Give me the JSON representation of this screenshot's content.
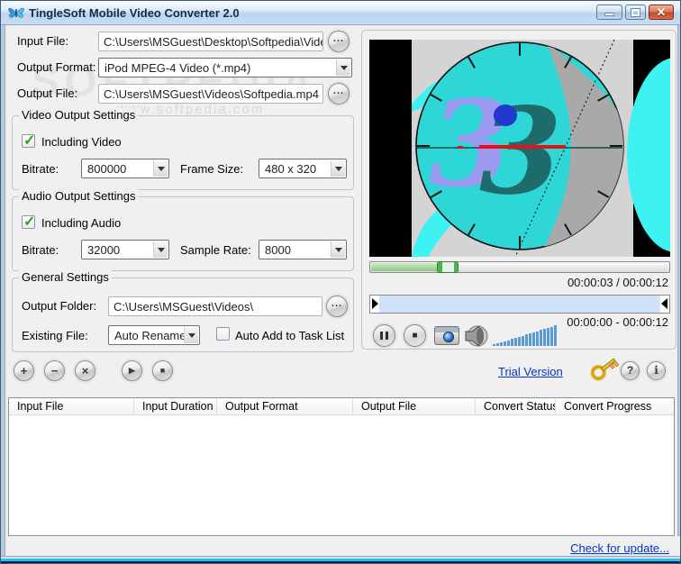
{
  "window": {
    "title": "TingleSoft Mobile Video Converter 2.0"
  },
  "watermark": {
    "line1": "SOFTPEDIA",
    "line2": "www.softpedia.com"
  },
  "file_section": {
    "input_file": {
      "label": "Input File:",
      "value": "C:\\Users\\MSGuest\\Desktop\\Softpedia\\Video\\Softp",
      "browse": "..."
    },
    "output_format": {
      "label": "Output Format:",
      "value": "iPod MPEG-4 Video (*.mp4)"
    },
    "output_file": {
      "label": "Output File:",
      "value": "C:\\Users\\MSGuest\\Videos\\Softpedia.mp4",
      "browse": "..."
    }
  },
  "video_settings": {
    "title": "Video Output Settings",
    "including_label": "Including Video",
    "including_checked": true,
    "bitrate_label": "Bitrate:",
    "bitrate_value": "800000",
    "frame_size_label": "Frame Size:",
    "frame_size_value": "480 x 320"
  },
  "audio_settings": {
    "title": "Audio Output Settings",
    "including_label": "Including Audio",
    "including_checked": true,
    "bitrate_label": "Bitrate:",
    "bitrate_value": "32000",
    "sample_rate_label": "Sample Rate:",
    "sample_rate_value": "8000"
  },
  "general_settings": {
    "title": "General Settings",
    "output_folder_label": "Output Folder:",
    "output_folder_value": "C:\\Users\\MSGuest\\Videos\\",
    "browse": "...",
    "existing_file_label": "Existing File:",
    "existing_file_value": "Auto Rename",
    "auto_add_label": "Auto Add to Task List",
    "auto_add_checked": false
  },
  "toolbar_glyphs": {
    "add": "+",
    "remove": "−",
    "clear": "×",
    "start": "▶",
    "stop": "■"
  },
  "preview": {
    "digit_back": "3",
    "digit_front": "3",
    "position_time": "00:00:03 / 00:00:12",
    "range_time": "00:00:00 - 00:00:12",
    "stop_glyph": "■"
  },
  "trial": {
    "link": "Trial Version",
    "help_glyph": "?",
    "about_glyph": "i"
  },
  "table": {
    "columns": [
      "Input File",
      "Input Duration",
      "Output Format",
      "Output File",
      "Convert Status",
      "Convert Progress"
    ],
    "rows": []
  },
  "footer": {
    "update_link": "Check for update..."
  },
  "colors": {
    "titlebar_blue": "#bcd4ee",
    "close_red": "#bf4a2a",
    "link_blue": "#0033cc",
    "volume_bar": "#5b9bd5",
    "seek_green": "#8cc884",
    "range_fill": "#cfe2f7",
    "video_cyan": "#2fd6d6",
    "video_bright_cyan": "#3ef2f2",
    "video_gray": "#a9a9a9",
    "digit_back_purple": "#9a9af0",
    "digit_front_teal": "#1d6b6b",
    "clock_hand_red": "#e81010",
    "key_gold": "#edb92e"
  }
}
